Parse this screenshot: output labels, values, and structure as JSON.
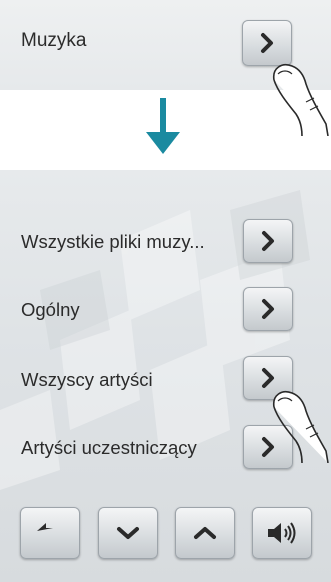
{
  "top": {
    "label": "Muzyka",
    "button_icon": "chevron-right-icon"
  },
  "transition_arrow": {
    "icon": "arrow-down-icon",
    "color": "#1a8aa0"
  },
  "menu": {
    "items": [
      {
        "label": "Wszystkie pliki muzy..."
      },
      {
        "label": "Ogólny"
      },
      {
        "label": "Wszyscy artyści"
      },
      {
        "label": "Artyści uczestniczący"
      }
    ]
  },
  "toolbar": {
    "buttons": [
      {
        "icon": "back-arrow-icon"
      },
      {
        "icon": "chevron-down-icon"
      },
      {
        "icon": "chevron-up-icon"
      },
      {
        "icon": "volume-icon"
      }
    ]
  }
}
